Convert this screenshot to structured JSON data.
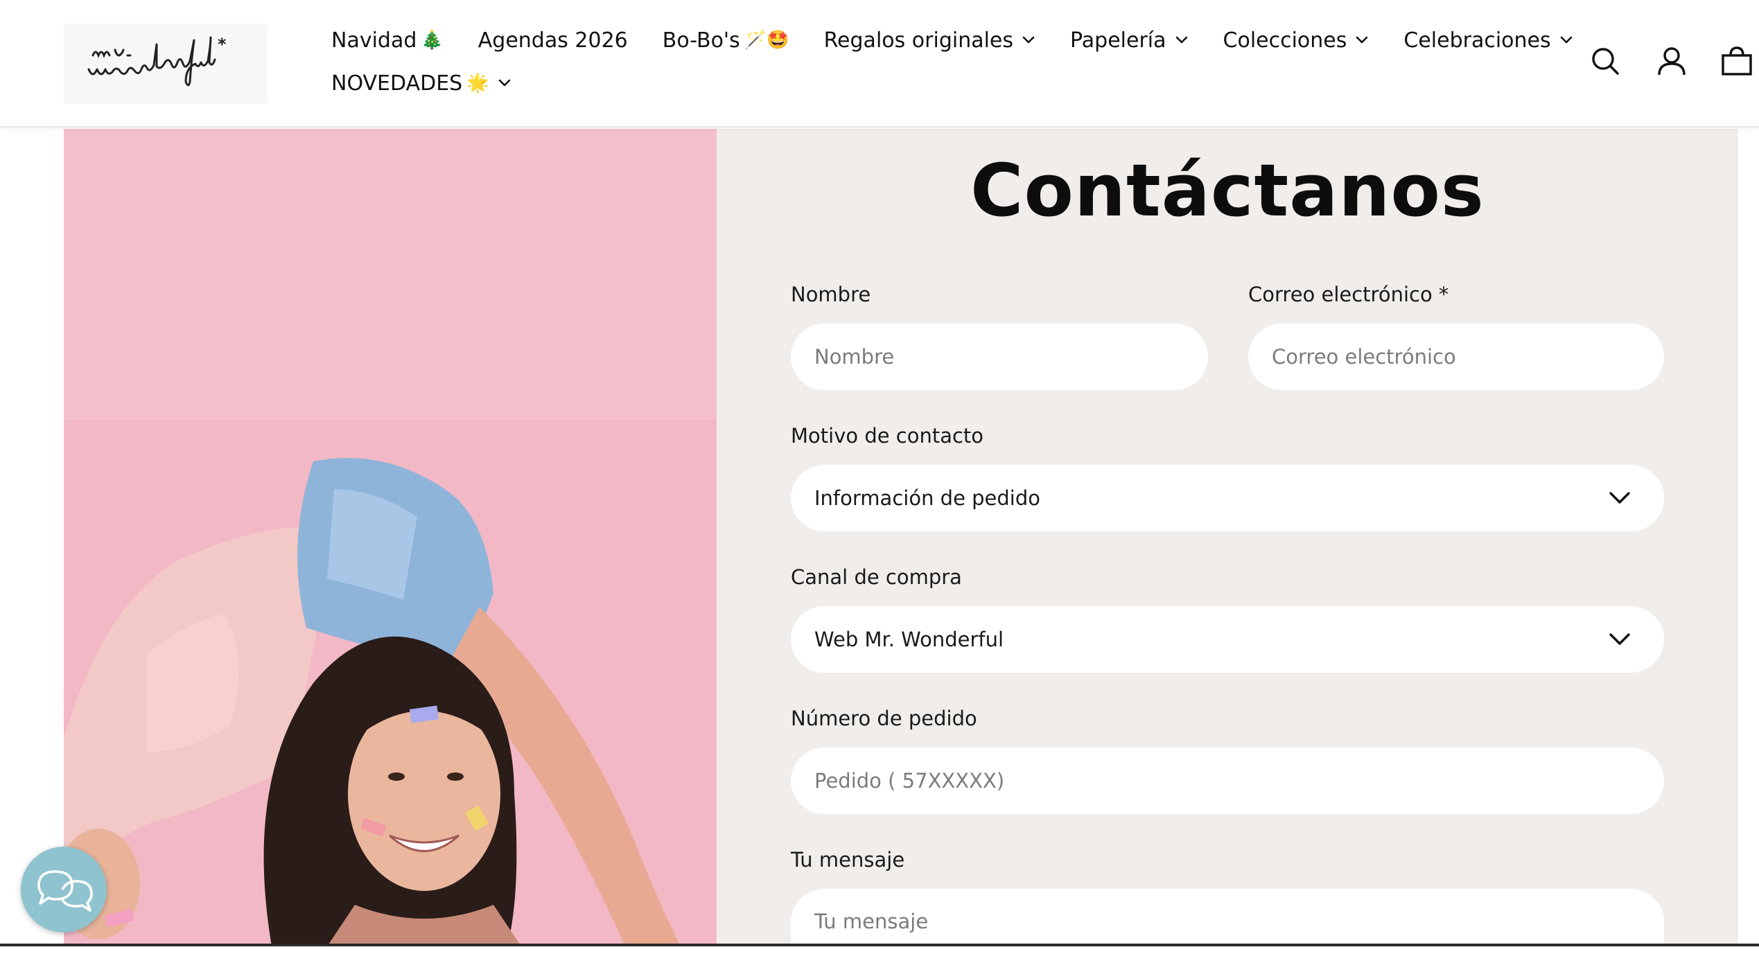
{
  "header": {
    "logo_text": "mr. wonderful*",
    "nav_row1": [
      {
        "label": "Navidad",
        "emoji": "🎄",
        "has_chevron": false
      },
      {
        "label": "Agendas 2026",
        "emoji": "",
        "has_chevron": false
      },
      {
        "label": "Bo-Bo's",
        "emoji": "🪄🤩",
        "has_chevron": false
      },
      {
        "label": "Regalos originales",
        "emoji": "",
        "has_chevron": true
      },
      {
        "label": "Papelería",
        "emoji": "",
        "has_chevron": true
      },
      {
        "label": "Colecciones",
        "emoji": "",
        "has_chevron": true
      },
      {
        "label": "Celebraciones",
        "emoji": "",
        "has_chevron": true
      }
    ],
    "nav_row2": [
      {
        "label": "NOVEDADES",
        "emoji": "🌟",
        "has_chevron": true
      }
    ],
    "icons": [
      "search-icon",
      "account-icon",
      "cart-icon"
    ]
  },
  "form": {
    "title": "Contáctanos",
    "name": {
      "label": "Nombre",
      "placeholder": "Nombre"
    },
    "email": {
      "label": "Correo electrónico *",
      "placeholder": "Correo electrónico"
    },
    "reason": {
      "label": "Motivo de contacto",
      "value": "Información de pedido"
    },
    "channel": {
      "label": "Canal de compra",
      "value": "Web Mr. Wonderful"
    },
    "order": {
      "label": "Número de pedido",
      "placeholder": "Pedido ( 57XXXXX)"
    },
    "message": {
      "label": "Tu mensaje",
      "placeholder": "Tu mensaje"
    }
  },
  "colors": {
    "form_bg": "#f0edea",
    "hero_bg": "#f3b6c4",
    "chat_bubble": "#8fc3cf"
  },
  "chat": {
    "icon": "chat-bubbles-icon"
  }
}
